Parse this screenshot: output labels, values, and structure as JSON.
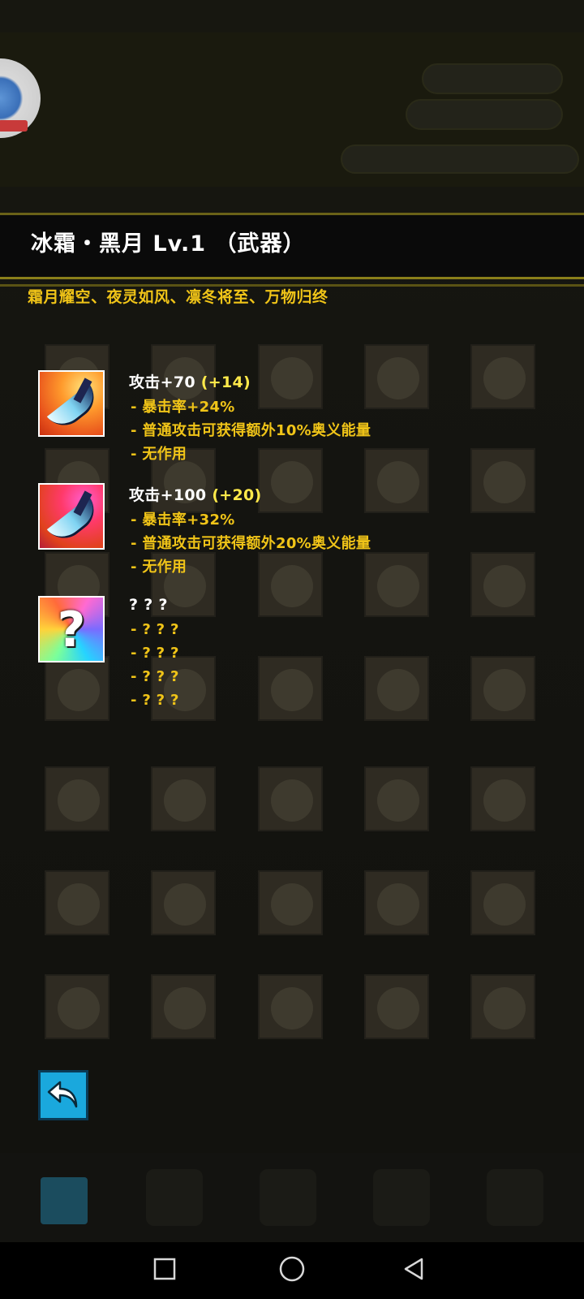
{
  "item": {
    "title": "冰霜・黑月 Lv.1 （武器）",
    "flavor": "霜月耀空、夜灵如风、凛冬将至、万物归终"
  },
  "tiers": [
    {
      "icon": "frost-blade-icon",
      "head_main": "攻击+70",
      "head_bonus": "(+14)",
      "lines": [
        "- 暴击率+24%",
        "- 普通攻击可获得额外10%奥义能量",
        "- 无作用"
      ]
    },
    {
      "icon": "frost-blade-icon",
      "head_main": "攻击+100",
      "head_bonus": "(+20)",
      "lines": [
        "- 暴击率+32%",
        "- 普通攻击可获得额外20%奥义能量",
        "- 无作用"
      ]
    },
    {
      "icon": "unknown-item-icon",
      "head_main": "? ? ?",
      "head_bonus": "",
      "lines": [
        "- ? ? ?",
        "- ? ? ?",
        "- ? ? ?",
        "- ? ? ?"
      ]
    }
  ],
  "controls": {
    "back_icon": "back-arrow-icon"
  },
  "colors": {
    "accent_yellow": "#f0c418",
    "bonus_yellow": "#ffe94a",
    "back_button": "#1aa8dd"
  }
}
